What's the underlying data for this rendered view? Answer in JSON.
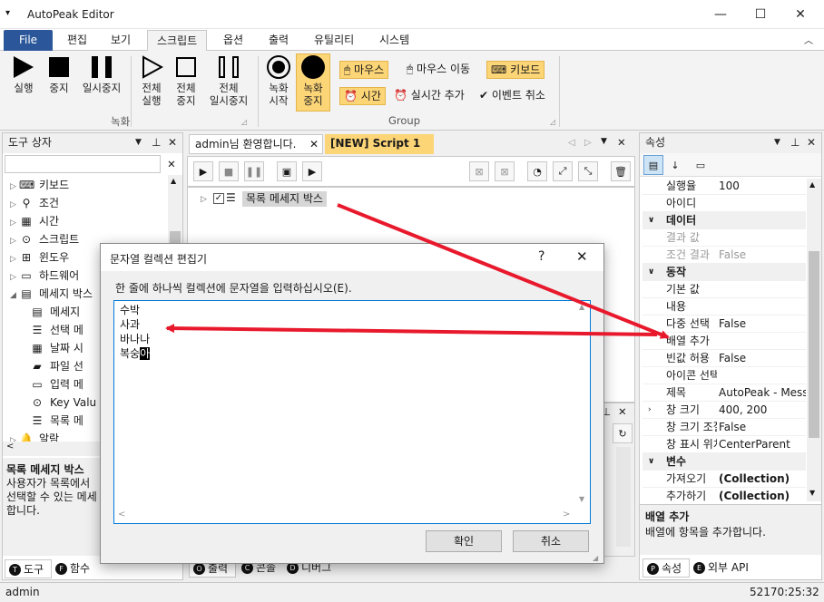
{
  "window": {
    "title": "AutoPeak Editor"
  },
  "menu_tabs": [
    "File",
    "편집",
    "보기",
    "스크립트",
    "옵션",
    "출력",
    "유틸리티",
    "시스템"
  ],
  "ribbon": {
    "play": "실행",
    "stop": "중지",
    "pause": "일시중지",
    "all_play": [
      "전체",
      "실행"
    ],
    "all_stop": [
      "전체",
      "중지"
    ],
    "all_pause": [
      "전체",
      "일시중지"
    ],
    "group_record": "녹화",
    "rec_start": [
      "녹화",
      "시작"
    ],
    "rec_stop": [
      "녹화",
      "중지"
    ],
    "mouse": "마우스",
    "mouse_move": "마우스 이동",
    "keyboard": "키보드",
    "time": "시간",
    "realtime_add": "실시간 추가",
    "event_cancel": "이벤트 취소",
    "group_group": "Group"
  },
  "toolbox": {
    "title": "도구 상자",
    "items": [
      "키보드",
      "조건",
      "시간",
      "스크립트",
      "윈도우",
      "하드웨어",
      "메세지 박스"
    ],
    "sub_items": [
      "메세지",
      "선택 메",
      "날짜 시",
      "파일 선",
      "입력 메",
      "Key Valu",
      "목록 메"
    ],
    "last_item": "알람",
    "desc_title": "목록 메세지 박스",
    "desc_lines": [
      "사용자가 목록에서",
      "선택할 수 있는 메세",
      "합니다."
    ],
    "bottom_tabs": [
      "도구",
      "함수"
    ]
  },
  "editor": {
    "tabs": [
      "admin님 환영합니다.",
      "[NEW] Script 1"
    ],
    "node_label": "목록 메세지 박스",
    "bottom_tabs": [
      "출력",
      "콘솔",
      "디버그"
    ]
  },
  "properties": {
    "title": "속성",
    "rows": [
      {
        "name": "실행율",
        "value": "100"
      },
      {
        "name": "아이디",
        "value": ""
      },
      {
        "cat": "데이터"
      },
      {
        "name": "결과 값",
        "value": "",
        "gray": true
      },
      {
        "name": "조건 결과",
        "value": "False",
        "gray": true
      },
      {
        "cat": "동작"
      },
      {
        "name": "기본 값",
        "value": ""
      },
      {
        "name": "내용",
        "value": ""
      },
      {
        "name": "다중 선택",
        "value": "False"
      },
      {
        "name": "배열 추가",
        "value": ""
      },
      {
        "name": "빈값 허용",
        "value": "False"
      },
      {
        "name": "아이콘 선택",
        "value": ""
      },
      {
        "name": "제목",
        "value": "AutoPeak - Message"
      },
      {
        "name": "창 크기",
        "value": "400, 200",
        "expand": true
      },
      {
        "name": "창 크기 조절",
        "value": "False"
      },
      {
        "name": "창 표시 위치",
        "value": "CenterParent"
      },
      {
        "cat": "변수"
      },
      {
        "name": "가져오기",
        "value": "(Collection)",
        "bold": true
      },
      {
        "name": "추가하기",
        "value": "(Collection)",
        "bold": true
      }
    ],
    "desc_title": "배열 추가",
    "desc_text": "배열에 항목을 추가합니다.",
    "bottom_tabs": [
      "속성",
      "외부 API"
    ]
  },
  "dialog": {
    "title": "문자열 컬렉션 편집기",
    "help": "?",
    "instruction": "한 줄에 하나씩 컬렉션에 문자열을 입력하십시오(E).",
    "lines": [
      "수박",
      "사과",
      "바나나",
      "복숭"
    ],
    "selected_tail": "아",
    "ok": "확인",
    "cancel": "취소"
  },
  "status": {
    "user": "admin",
    "time": "52170:25:32"
  },
  "colors": {
    "accent": "#2b579a",
    "highlight": "#fcd577",
    "arrow": "#e8192c"
  }
}
